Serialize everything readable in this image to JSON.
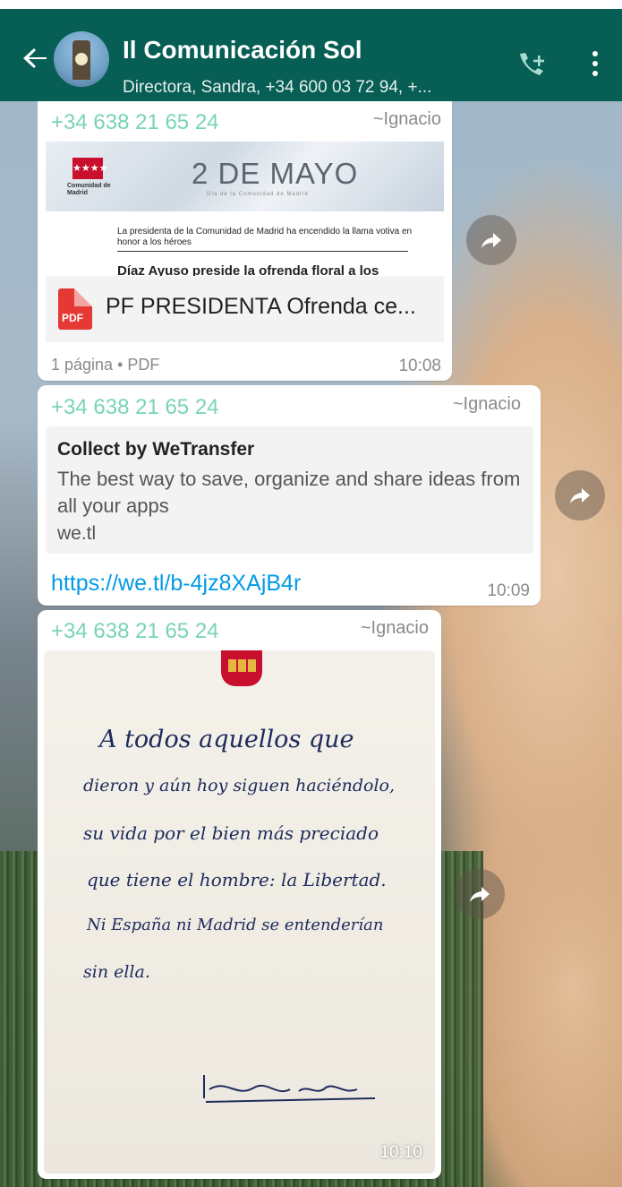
{
  "header": {
    "title": "Il Comunicación Sol",
    "subtitle": "Directora, Sandra, +34 600 03 72 94, +...",
    "back_icon": "arrow-left-icon",
    "add_call_icon": "add-call-icon",
    "menu_icon": "more-vert-icon"
  },
  "messages": [
    {
      "sender": "+34 638 21 65 24",
      "alias": "~Ignacio",
      "type": "document",
      "preview": {
        "logo_text": "Comunidad de Madrid",
        "heading": "2 DE MAYO",
        "subheading": "Día de la Comunidad de Madrid",
        "line": "La presidenta de la Comunidad de Madrid ha encendido la llama votiva en honor a los héroes",
        "bold": "Díaz Ayuso preside la ofrenda floral a los"
      },
      "file_icon_label": "PDF",
      "file_name": "PF PRESIDENTA Ofrenda ce...",
      "meta": "1 página • PDF",
      "time": "10:08"
    },
    {
      "sender": "+34 638 21 65 24",
      "alias": "~Ignacio",
      "type": "link",
      "link_title": "Collect by WeTransfer",
      "link_description": "The best way to save, organize and share ideas from all your apps",
      "link_domain": "we.tl",
      "url": "https://we.tl/b-4jz8XAjB4r",
      "time": "10:09"
    },
    {
      "sender": "+34 638 21 65 24",
      "alias": "~Ignacio",
      "type": "image",
      "handwriting": [
        "A todos aquellos que",
        "dieron y aún hoy siguen haciéndolo,",
        "su vida por el bien más preciado",
        "que tiene el hombre: la Libertad.",
        "Ni España ni Madrid se entenderían",
        "sin ella."
      ],
      "signature": "Isabel Díaz Ayuso",
      "time": "10:10"
    }
  ],
  "colors": {
    "header": "#075e54",
    "sender": "#78d4b5",
    "link": "#039be5",
    "pdf": "#e53935"
  }
}
